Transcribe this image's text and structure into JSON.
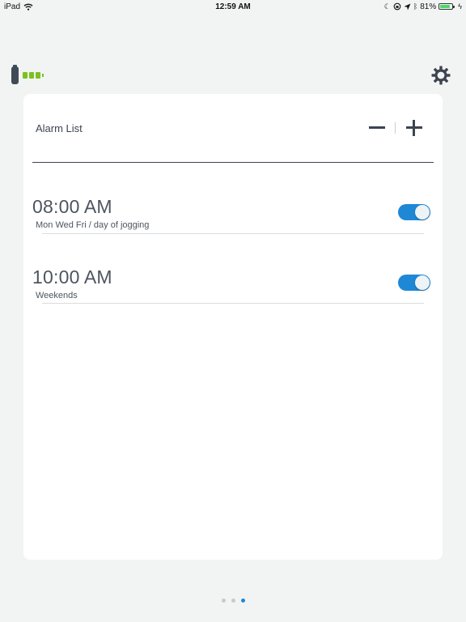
{
  "status_bar": {
    "device": "iPad",
    "time": "12:59 AM",
    "battery_percent": "81%",
    "battery_level": 0.81,
    "icons": [
      "wifi-icon",
      "moon-icon",
      "orientation-lock-icon",
      "location-icon",
      "bluetooth-icon",
      "battery-icon",
      "charging-icon"
    ]
  },
  "header": {
    "device_icon": "band-device-icon",
    "device_battery_icon": "battery-icon",
    "settings_icon": "gear-icon"
  },
  "alarm_list": {
    "title": "Alarm List",
    "remove_icon": "minus-icon",
    "add_icon": "plus-icon",
    "items": [
      {
        "time": "08:00 AM",
        "label": "Mon Wed Fri / day of jogging",
        "enabled": true
      },
      {
        "time": "10:00 AM",
        "label": "Weekends",
        "enabled": true
      }
    ]
  },
  "pager": {
    "pages": 3,
    "active_page": 3
  },
  "colors": {
    "accent": "#1e88d6",
    "device_battery": "#7cc11f",
    "text": "#3d4450",
    "background": "#f2f4f4"
  }
}
